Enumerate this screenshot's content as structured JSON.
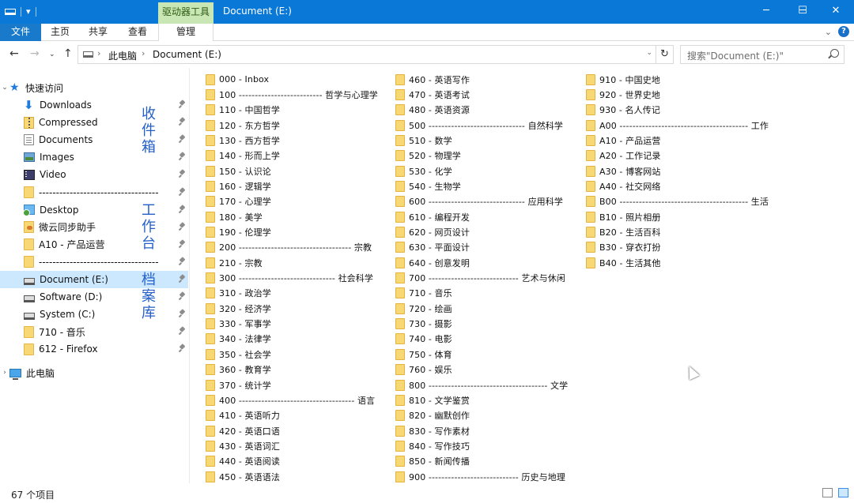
{
  "titlebar": {
    "context_tab": "驱动器工具",
    "window_title": "Document (E:)",
    "minimize": "─",
    "maximize": "☐",
    "close": "✕"
  },
  "ribbon": {
    "tabs": [
      "文件",
      "主页",
      "共享",
      "查看",
      "管理"
    ],
    "help": "?"
  },
  "address": {
    "segments": [
      "此电脑",
      "Document (E:)"
    ],
    "search_placeholder": "搜索\"Document (E:)\""
  },
  "nav": {
    "quick_access": "快速访问",
    "items": [
      {
        "label": "Downloads",
        "icon": "download-icon"
      },
      {
        "label": "Compressed",
        "icon": "compressed-folder-icon"
      },
      {
        "label": "Documents",
        "icon": "documents-icon"
      },
      {
        "label": "Images",
        "icon": "images-icon"
      },
      {
        "label": "Video",
        "icon": "video-icon"
      },
      {
        "label": "-----------------------------------",
        "icon": "folder-icon"
      },
      {
        "label": "Desktop",
        "icon": "desktop-icon"
      },
      {
        "label": "微云同步助手",
        "icon": "cloud-folder-icon"
      },
      {
        "label": "A10 - 产品运营",
        "icon": "folder-icon"
      },
      {
        "label": "-----------------------------------",
        "icon": "folder-icon"
      },
      {
        "label": "Document (E:)",
        "icon": "drive-icon"
      },
      {
        "label": "Software (D:)",
        "icon": "drive-icon"
      },
      {
        "label": "System (C:)",
        "icon": "drive-icon"
      },
      {
        "label": "710 - 音乐",
        "icon": "folder-icon"
      },
      {
        "label": "612 - Firefox",
        "icon": "folder-icon"
      }
    ],
    "this_pc": "此电脑",
    "annotations": [
      "收件箱",
      "工作台",
      "档案库"
    ]
  },
  "files": {
    "col1": [
      "000 - Inbox",
      "100 -------------------------- 哲学与心理学",
      "110 - 中国哲学",
      "120 - 东方哲学",
      "130 - 西方哲学",
      "140 - 形而上学",
      "150 - 认识论",
      "160 - 逻辑学",
      "170 - 心理学",
      "180 - 美学",
      "190 - 伦理学",
      "200 ----------------------------------- 宗教",
      "210 - 宗教",
      "300 ------------------------------ 社会科学",
      "310 - 政治学",
      "320 - 经济学",
      "330 - 军事学",
      "340 - 法律学",
      "350 - 社会学",
      "360 - 教育学",
      "370 - 统计学",
      "400 ------------------------------------ 语言",
      "410 - 英语听力",
      "420 - 英语口语",
      "430 - 英语词汇",
      "440 - 英语阅读",
      "450 - 英语语法"
    ],
    "col2": [
      "460 - 英语写作",
      "470 - 英语考试",
      "480 - 英语资源",
      "500 ------------------------------ 自然科学",
      "510 - 数学",
      "520 - 物理学",
      "530 - 化学",
      "540 - 生物学",
      "600 ------------------------------ 应用科学",
      "610 - 编程开发",
      "620 - 网页设计",
      "630 - 平面设计",
      "640 - 创意发明",
      "700 ---------------------------- 艺术与休闲",
      "710 - 音乐",
      "720 - 绘画",
      "730 - 摄影",
      "740 - 电影",
      "750 - 体育",
      "760 - 娱乐",
      "800 ------------------------------------- 文学",
      "810 - 文学鉴赏",
      "820 - 幽默创作",
      "830 - 写作素材",
      "840 - 写作技巧",
      "850 - 新闻传播",
      "900 ---------------------------- 历史与地理"
    ],
    "col3": [
      "910 - 中国史地",
      "920 - 世界史地",
      "930 - 名人传记",
      "A00 ---------------------------------------- 工作",
      "A10 - 产品运营",
      "A20 - 工作记录",
      "A30 - 博客网站",
      "A40 - 社交网络",
      "B00 ---------------------------------------- 生活",
      "B10 - 照片相册",
      "B20 - 生活百科",
      "B30 - 穿衣打扮",
      "B40 - 生活其他"
    ]
  },
  "status": {
    "count": "67 个项目"
  },
  "colors": {
    "titlebar": "#0a78d7",
    "context_tab": "#c9e7b4",
    "selection": "#cce8ff",
    "annotation": "#2460c8"
  }
}
